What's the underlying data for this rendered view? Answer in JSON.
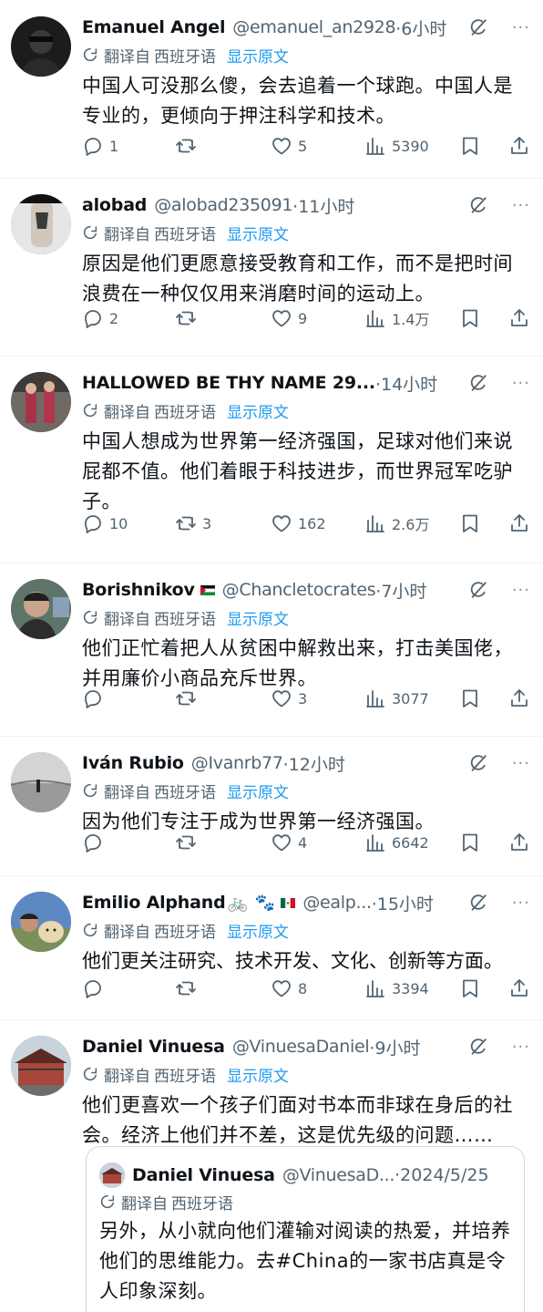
{
  "ui": {
    "translated_from": "翻译自",
    "language": "西班牙语",
    "show_original": "显示原文",
    "more": "···"
  },
  "tweets": [
    {
      "name": "Emanuel Angel",
      "handle": "@emanuel_an2928",
      "time": "·6小时",
      "text": "中国人可没那么傻，会去追着一个球跑。中国人是专业的，更倾向于押注科学和技术。",
      "replies": "1",
      "reposts": "",
      "likes": "5",
      "views": "5390"
    },
    {
      "name": "alobad",
      "handle": "@alobad235091",
      "time": "·11小时",
      "text": "原因是他们更愿意接受教育和工作，而不是把时间浪费在一种仅仅用来消磨时间的运动上。",
      "replies": "2",
      "reposts": "",
      "likes": "9",
      "views": "1.4万"
    },
    {
      "name": "HALLOWED BE THY NAME 29...",
      "handle": "",
      "time": "·14小时",
      "text": "中国人想成为世界第一经济强国，足球对他们来说屁都不值。他们着眼于科技进步，而世界冠军吃驴子。",
      "replies": "10",
      "reposts": "3",
      "likes": "162",
      "views": "2.6万"
    },
    {
      "name": "Borishnikov",
      "handle": "@Chancletocrates",
      "time": "·7小时",
      "text": "他们正忙着把人从贫困中解救出来，打击美国佬，并用廉价小商品充斥世界。",
      "replies": "",
      "reposts": "",
      "likes": "3",
      "views": "3077"
    },
    {
      "name": "Iván Rubio",
      "handle": "@Ivanrb77",
      "time": "·12小时",
      "text": "因为他们专注于成为世界第一经济强国。",
      "replies": "",
      "reposts": "",
      "likes": "4",
      "views": "6642"
    },
    {
      "name": "Emilio Alphand",
      "handle": "@ealp...",
      "time": "·15小时",
      "text": "他们更关注研究、技术开发、文化、创新等方面。",
      "replies": "",
      "reposts": "",
      "likes": "8",
      "views": "3394"
    },
    {
      "name": "Daniel Vinuesa",
      "handle": "@VinuesaDaniel",
      "time": "·9小时",
      "text": "他们更喜欢一个孩子们面对书本而非球在身后的社会。经济上他们并不差，这是优先级的问题……"
    }
  ],
  "quote": {
    "name": "Daniel Vinuesa",
    "handle": "@VinuesaD...",
    "date": "·2024/5/25",
    "translated_from": "翻译自",
    "language": "西班牙语",
    "text": "另外，从小就向他们灌输对阅读的热爱，并培养他们的思维能力。去#China的一家书店真是令人印象深刻。"
  },
  "emoji": {
    "bike": "🚲",
    "paws": "🐾"
  },
  "colors": {
    "text": "#0f1419",
    "secondary": "#536471",
    "link": "#1d9bf0",
    "border": "#cfd9de"
  }
}
